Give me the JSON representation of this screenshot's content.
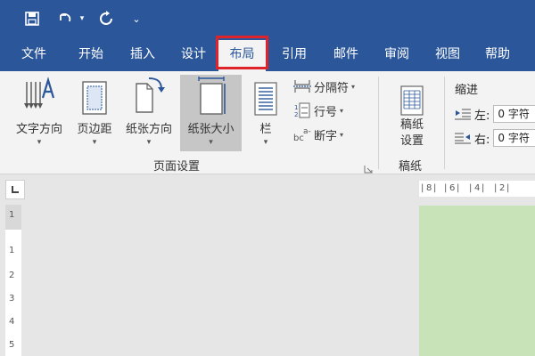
{
  "quick_access": {
    "more_label": "⌄"
  },
  "tabs": [
    {
      "label": "文件"
    },
    {
      "label": "开始"
    },
    {
      "label": "插入"
    },
    {
      "label": "设计"
    },
    {
      "label": "布局",
      "active": true
    },
    {
      "label": "引用"
    },
    {
      "label": "邮件"
    },
    {
      "label": "审阅"
    },
    {
      "label": "视图"
    },
    {
      "label": "帮助"
    }
  ],
  "ribbon": {
    "page_setup": {
      "text_direction": "文字方向",
      "margins": "页边距",
      "orientation": "纸张方向",
      "size": "纸张大小",
      "columns": "栏",
      "breaks": "分隔符",
      "line_numbers": "行号",
      "hyphenation": "断字",
      "group_label": "页面设置"
    },
    "manuscript": {
      "setup_line1": "稿纸",
      "setup_line2": "设置",
      "group_label": "稿纸"
    },
    "indent": {
      "title": "缩进",
      "left_label": "左:",
      "left_value": "0 字符",
      "right_label": "右:",
      "right_value": "0 字符"
    }
  },
  "rulers": {
    "horizontal": [
      "8",
      "6",
      "4",
      "2"
    ],
    "vertical": [
      "1",
      "1",
      "2",
      "3",
      "4",
      "5"
    ]
  },
  "colors": {
    "accent": "#2b579a",
    "highlight": "#e0232a",
    "page": "#c9e3b8"
  }
}
